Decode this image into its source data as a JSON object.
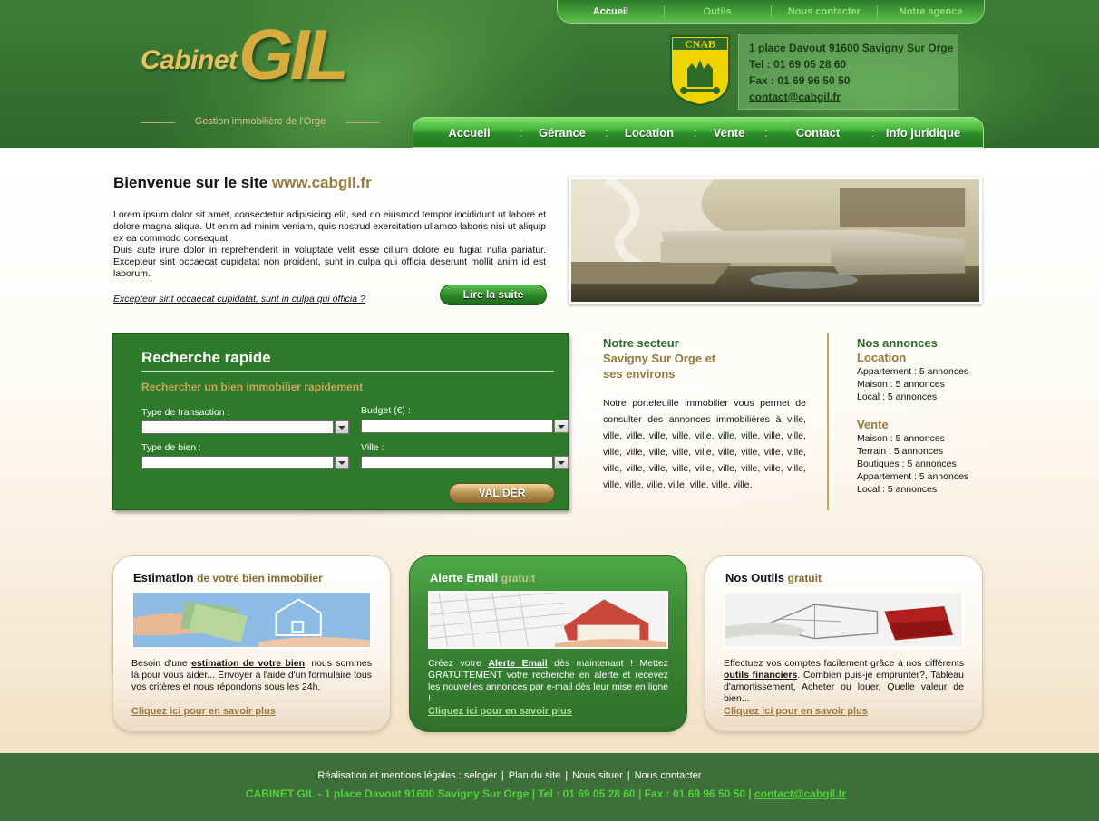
{
  "top_nav": [
    {
      "label": "Accueil",
      "active": true
    },
    {
      "label": "Outils",
      "active": false
    },
    {
      "label": "Nous contacter",
      "active": false
    },
    {
      "label": "Notre agence",
      "active": false
    }
  ],
  "logo": {
    "word1": "Cabinet",
    "word2": "GIL",
    "tagline": "Gestion immobilière de l'Orge"
  },
  "cnab_label": "CNAB",
  "contact": {
    "address": "1 place Davout  91600 Savigny Sur Orge",
    "tel": "Tel : 01 69 05 28 60",
    "fax": "Fax : 01 69 96 50 50",
    "email": "contact@cabgil.fr"
  },
  "main_nav": [
    "Accueil",
    "Gérance",
    "Location",
    "Vente",
    "Contact",
    "Info juridique"
  ],
  "welcome": {
    "title": "Bienvenue sur le site",
    "site": "www.cabgil.fr",
    "p1": "Lorem ipsum dolor sit amet, consectetur adipisicing elit, sed do eiusmod tempor incididunt ut labore et dolore magna aliqua. Ut enim ad minim veniam, quis nostrud exercitation ullamco laboris nisi ut aliquip ex ea commodo consequat.",
    "p2": "Duis aute irure dolor in reprehenderit in voluptate velit esse cillum dolore eu fugiat nulla pariatur. Excepteur sint occaecat cupidatat non proident, sunt in culpa qui officia deserunt mollit anim id est laborum.",
    "link": "Excepteur sint occaecat cupidatat, sunt in culpa qui officia ?",
    "button": "Lire la suite"
  },
  "search": {
    "title": "Recherche rapide",
    "subtitle": "Rechercher un bien immobilier rapidement",
    "transaction_label": "Type de transaction :",
    "budget_label": "Budget (€) :",
    "bien_label": "Type de bien :",
    "ville_label": "Ville :",
    "transaction_value": "",
    "budget_value": "",
    "bien_value": "",
    "ville_value": "",
    "submit": "VALIDER"
  },
  "sector": {
    "title1": "Notre secteur",
    "title2": "Savigny Sur Orge et",
    "title3": "ses environs",
    "text": "Notre portefeuille immobilier vous permet de consulter des annonces immobilières à  ville, ville, ville, ville, ville, ville, ville, ville, ville, ville, ville, ville, ville, ville, ville, ville, ville, ville, ville, ville, ville, ville, ville, ville, ville, ville, ville, ville, ville, ville, ville, ville, ville, ville, ville,"
  },
  "annonces": {
    "title": "Nos annonces",
    "location_title": "Location",
    "location_items": [
      "Appartement : 5 annonces",
      "Maison : 5 annonces",
      "Local : 5 annonces"
    ],
    "vente_title": "Vente",
    "vente_items": [
      "Maison : 5 annonces",
      "Terrain : 5 annonces",
      "Boutiques : 5 annonces",
      "Appartement : 5 annonces",
      "Local : 5 annonces"
    ]
  },
  "cards": [
    {
      "title": "Estimation",
      "suffix": "de votre bien immobilier",
      "pre": "Besoin d'une ",
      "bold": "estimation de votre bien",
      "post": ", nous sommes là pour vous aider... Envoyer à l'aide d'un formulaire tous vos critères et nous répondons sous les 24h.",
      "more": "Cliquez ici pour en savoir plus"
    },
    {
      "title": "Alerte Email",
      "suffix": "gratuit",
      "pre": "Créez votre ",
      "bold": "Alerte Email",
      "post": " dès maintenant ! Mettez GRATUITEMENT votre recherche en alerte et recevez les nouvelles annonces par e-mail dès leur mise en ligne !",
      "more": "Cliquez ici pour en savoir plus"
    },
    {
      "title": "Nos Outils",
      "suffix": "gratuit",
      "pre": "Effectuez vos comptes facilement grâce à nos différents ",
      "bold": "outils financiers",
      "post": ". Combien puis-je emprunter?, Tableau d'amortissement, Acheter ou louer, Quelle valeur de bien...",
      "more": "Cliquez ici pour en savoir plus"
    }
  ],
  "footer": {
    "links": [
      "Réalisation et mentions légales : seloger",
      "Plan du site",
      "Nous situer",
      "Nous contacter"
    ],
    "address": "CABINET GIL - 1 place Davout  91600 Savigny Sur Orge",
    "tel": "Tel : 01 69 05 28 60",
    "fax": "Fax : 01 69 96 50 50",
    "email": "contact@cabgil.fr"
  },
  "colors": {
    "header_green": "#357030",
    "accent_gold": "#9a7a3a",
    "nav_green": "#3fae36",
    "footer_green": "#3e6f38",
    "footer_text": "#4fd23a"
  }
}
